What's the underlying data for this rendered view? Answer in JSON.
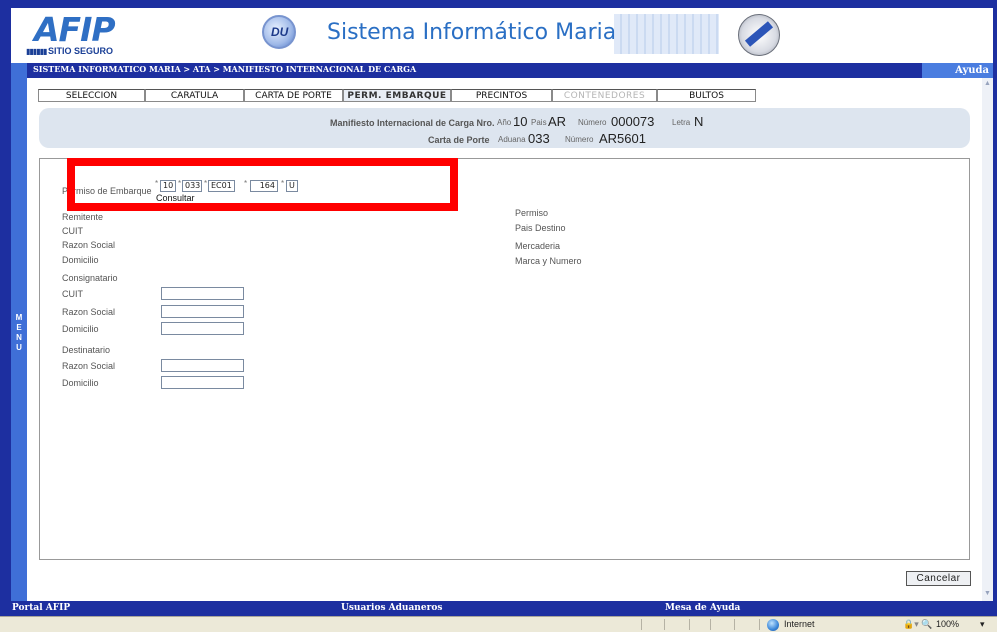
{
  "header": {
    "logo_text": "AFIP",
    "logo_sub": "SITIO SEGURO",
    "title": "Sistema Informático Maria"
  },
  "breadcrumb": "SISTEMA INFORMATICO MARIA > ATA > MANIFIESTO INTERNACIONAL DE CARGA",
  "help_label": "Ayuda",
  "side_menu_label": "MENU",
  "tabs": [
    {
      "label": "SELECCION"
    },
    {
      "label": "CARATULA"
    },
    {
      "label": "CARTA DE PORTE"
    },
    {
      "label": "PERM. EMBARQUE",
      "active": true
    },
    {
      "label": "PRECINTOS"
    },
    {
      "label": "CONTENEDORES",
      "disabled": true
    },
    {
      "label": "BULTOS"
    }
  ],
  "summary": {
    "manifest_label": "Manifiesto Internacional de Carga Nro.",
    "anio_label": "Año",
    "anio_value": "10",
    "pais_label": "Pais",
    "pais_value": "AR",
    "numero_label": "Número",
    "numero_value": "000073",
    "letra_label": "Letra",
    "letra_value": "N",
    "carta_label": "Carta de Porte",
    "aduana_label": "Aduana",
    "aduana_value": "033",
    "numero2_label": "Número",
    "numero2_value": "AR5601"
  },
  "permiso": {
    "label": "Permiso de Embarque",
    "f1": "10",
    "f2": "033",
    "f3": "EC01",
    "f4": "164",
    "f5": "U",
    "star": "*",
    "consultar": "Consultar"
  },
  "left_labels": {
    "remitente": "Remitente",
    "cuit": "CUIT",
    "razon_social": "Razon Social",
    "domicilio": "Domicilio",
    "consignatario": "Consignatario",
    "c_cuit": "CUIT",
    "c_razon_social": "Razon Social",
    "c_domicilio": "Domicilio",
    "destinatario": "Destinatario",
    "d_razon_social": "Razon Social",
    "d_domicilio": "Domicilio"
  },
  "right_labels": {
    "permiso": "Permiso",
    "pais_destino": "Pais Destino",
    "mercaderia": "Mercaderia",
    "marca": "Marca y Numero"
  },
  "cancel_label": "Cancelar",
  "footer": {
    "portal": "Portal AFIP",
    "usuarios": "Usuarios Aduaneros",
    "mesa": "Mesa de Ayuda"
  },
  "statusbar": {
    "zone": "Internet",
    "zoom": "100%",
    "zoom_menu": "▾"
  },
  "colors": {
    "frame": "#1d2fa0",
    "accent": "#2a6fc4",
    "highlight": "#ff0000"
  }
}
